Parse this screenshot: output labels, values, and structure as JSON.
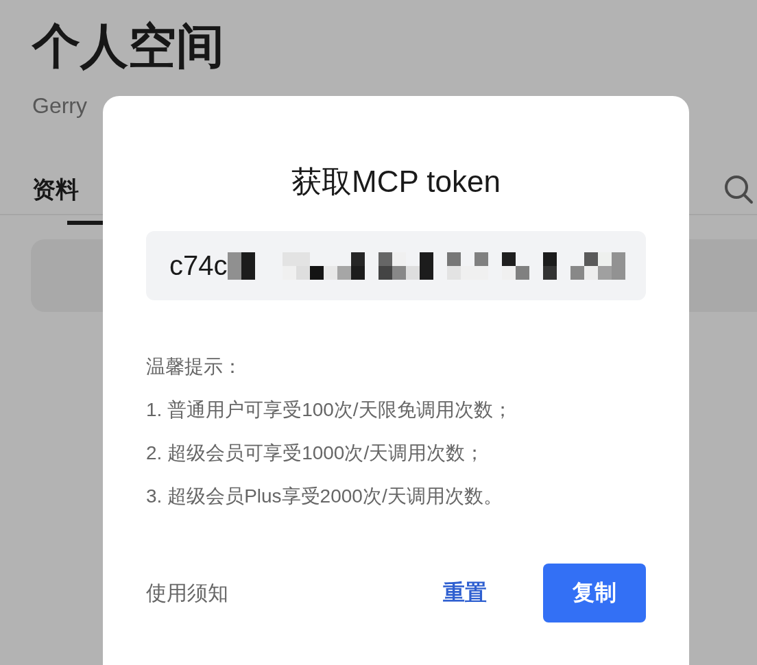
{
  "page": {
    "title": "个人空间",
    "subtitle": "Gerry",
    "tabs": [
      {
        "label": "资料",
        "selected": true
      }
    ]
  },
  "dialog": {
    "title": "获取MCP token",
    "token": {
      "value": "c74c",
      "redacted": true
    },
    "tips": {
      "heading": "温馨提示：",
      "items": [
        "1. 普通用户可享受100次/天限免调用次数；",
        "2. 超级会员可享受1000次/天调用次数；",
        "3. 超级会员Plus享受2000次/天调用次数。"
      ]
    },
    "notice_link": "使用须知",
    "reset_button": "重置",
    "copy_button": "复制"
  }
}
